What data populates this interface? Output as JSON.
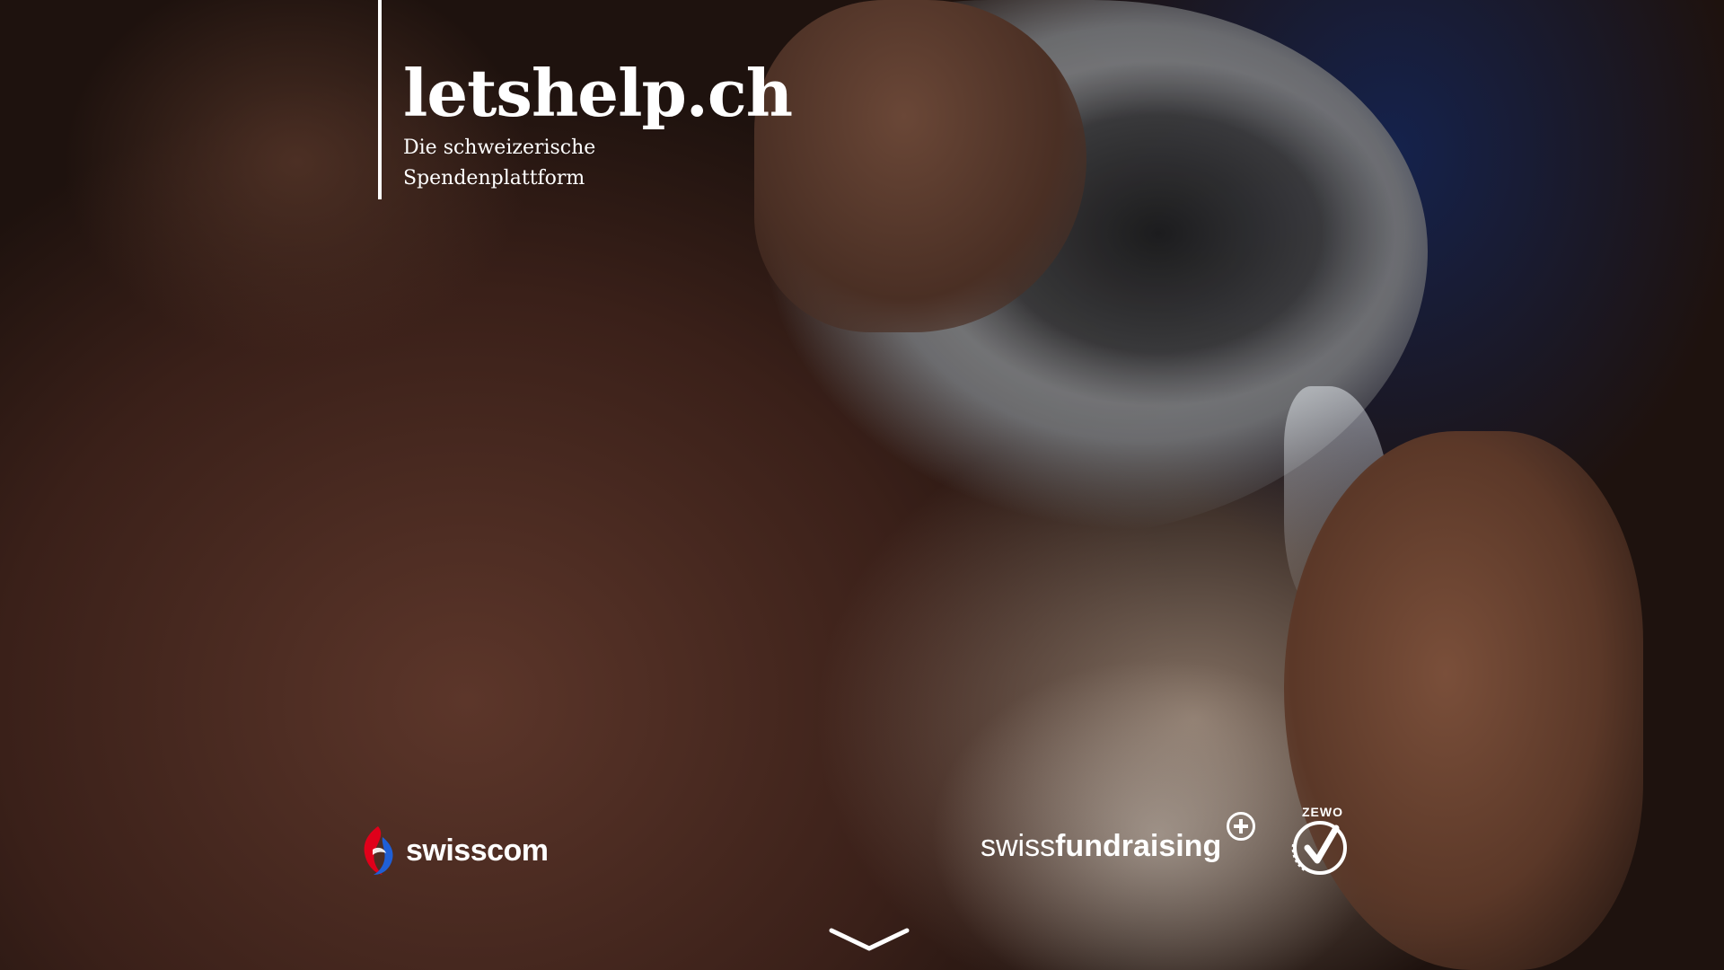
{
  "hero": {
    "background_image": "donation-water-hands-photo"
  },
  "brand": {
    "name": "letshelp.ch",
    "tagline_line1": "Die schweizerische",
    "tagline_line2": "Spendenplattform"
  },
  "partners": {
    "swisscom": {
      "label": "swisscom",
      "icon": "swisscom-logo-icon"
    },
    "swissfundraising": {
      "light": "swiss",
      "bold": "fundraising",
      "icon": "plus-circle-icon"
    },
    "zewo": {
      "label": "ZEWO",
      "icon": "zewo-seal-icon"
    }
  },
  "scroll": {
    "icon": "chevron-down-icon"
  },
  "colors": {
    "text": "#ffffff",
    "swisscom_red": "#e0001a",
    "swisscom_blue": "#1f5fd6"
  }
}
